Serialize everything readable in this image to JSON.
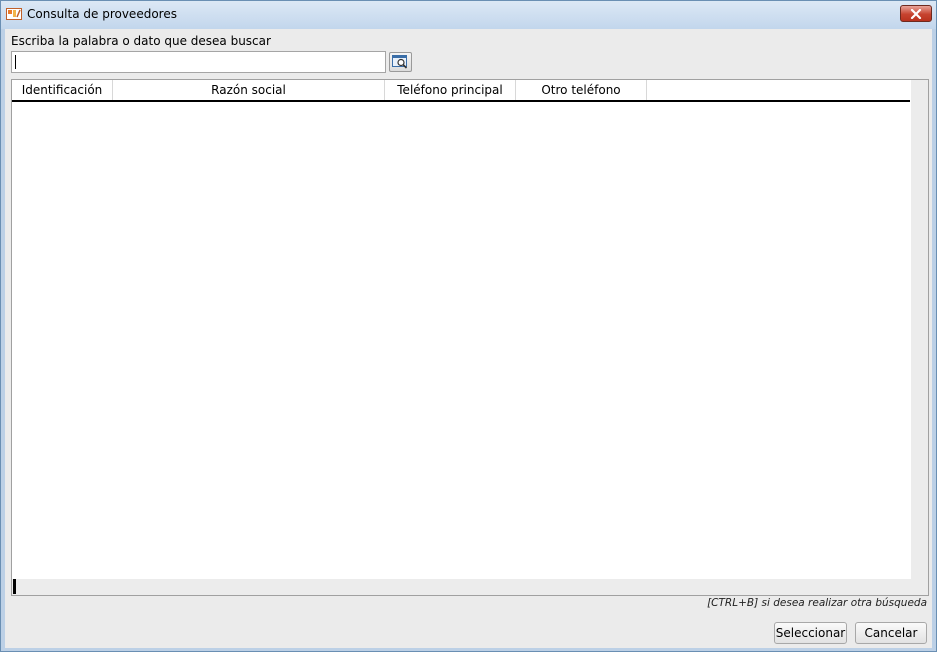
{
  "window": {
    "title": "Consulta de proveedores",
    "close_label": "✕"
  },
  "search": {
    "label": "Escriba la palabra o dato que desea buscar",
    "value": "",
    "placeholder": "",
    "button_icon": "search-window-icon"
  },
  "grid": {
    "columns": [
      "Identificación",
      "Razón social",
      "Teléfono principal",
      "Otro teléfono"
    ],
    "rows": []
  },
  "hint": "[CTRL+B] si desea realizar otra búsqueda",
  "buttons": {
    "select_label": "Seleccionar",
    "cancel_label": "Cancelar"
  },
  "colors": {
    "title_bar": "#c2d6ec",
    "close_button": "#c7432f",
    "client_bg": "#ebebeb"
  }
}
